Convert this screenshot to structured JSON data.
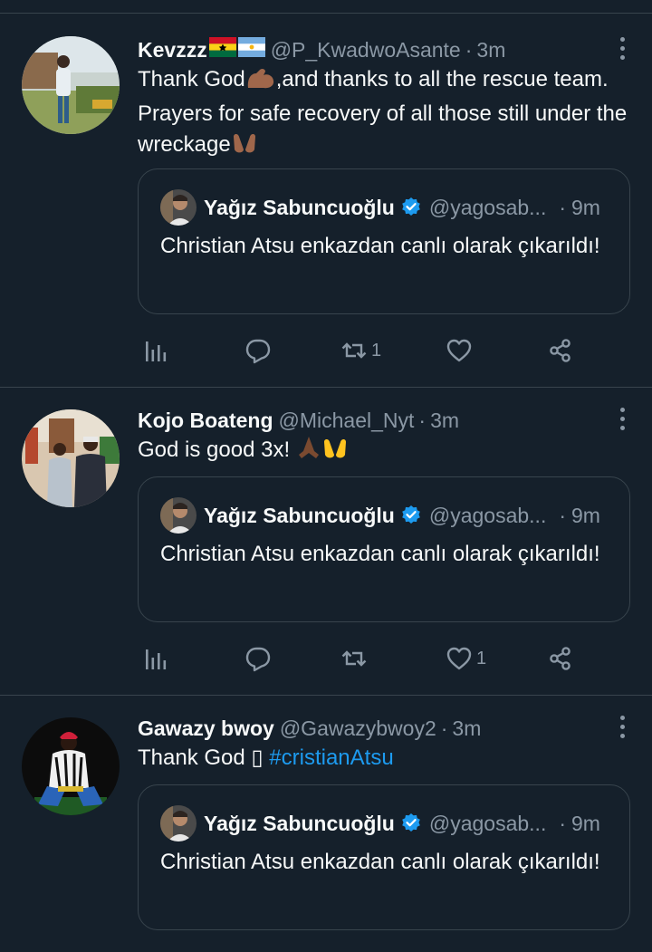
{
  "tweets": [
    {
      "name": "Kevzzz",
      "name_emoji": [
        "flag-ghana",
        "flag-argentina"
      ],
      "handle": "@P_KwadwoAsante",
      "time": "3m",
      "text_parts": [
        "Thank God",
        ",and thanks to all the rescue team. Prayers for safe recovery of all those still under the wreckage"
      ],
      "quote": {
        "name": "Yağız Sabuncuoğlu",
        "handle": "@yagosab...",
        "time": "9m",
        "text": "Christian Atsu enkazdan canlı olarak çıkarıldı!"
      },
      "actions": {
        "reply": "",
        "retweet": "1",
        "like": ""
      }
    },
    {
      "name": "Kojo Boateng",
      "handle": "@Michael_Nyt",
      "time": "3m",
      "text": "God is good 3x!",
      "quote": {
        "name": "Yağız Sabuncuoğlu",
        "handle": "@yagosab...",
        "time": "9m",
        "text": "Christian Atsu enkazdan canlı olarak çıkarıldı!"
      },
      "actions": {
        "reply": "",
        "retweet": "",
        "like": "1"
      }
    },
    {
      "name": "Gawazy bwoy",
      "handle": "@Gawazybwoy2",
      "time": "3m",
      "text": "Thank God ▯",
      "hashtag": "#cristianAtsu",
      "quote": {
        "name": "Yağız Sabuncuoğlu",
        "handle": "@yagosab...",
        "time": "9m",
        "text": "Christian Atsu enkazdan canlı olarak çıkarıldı!"
      }
    }
  ],
  "colors": {
    "background": "#15202b",
    "text": "#f7f9f9",
    "secondary": "#8b98a5",
    "border": "#38444d",
    "accent": "#1d9bf0"
  },
  "icons": [
    "analytics-icon",
    "reply-icon",
    "retweet-icon",
    "like-icon",
    "share-icon",
    "more-icon",
    "verified-badge-icon"
  ]
}
